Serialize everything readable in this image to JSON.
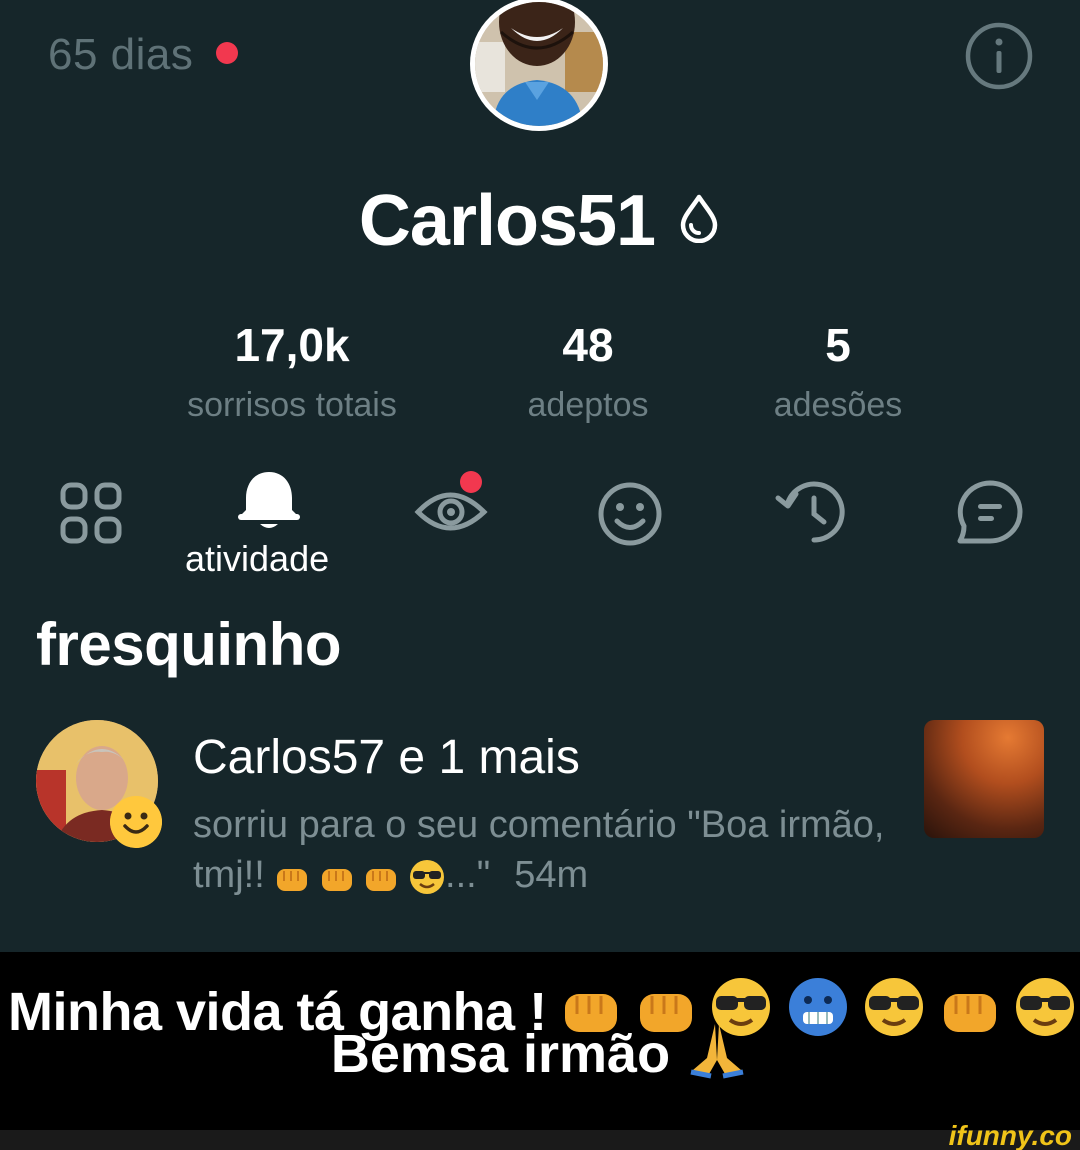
{
  "header": {
    "streak": "65 dias",
    "streak_dot_color": "#f2384f",
    "info_icon": "info-icon"
  },
  "profile": {
    "username": "Carlos51",
    "badge_icon": "water-drop-icon"
  },
  "stats": [
    {
      "value": "17,0k",
      "label": "sorrisos totais"
    },
    {
      "value": "48",
      "label": "adeptos"
    },
    {
      "value": "5",
      "label": "adesões"
    }
  ],
  "tabs": [
    {
      "icon": "grid-icon"
    },
    {
      "icon": "bell-icon",
      "label": "atividade",
      "active": true
    },
    {
      "icon": "eye-icon",
      "has_notification": true
    },
    {
      "icon": "smiley-icon"
    },
    {
      "icon": "history-icon"
    },
    {
      "icon": "chat-icon"
    }
  ],
  "section": {
    "title": "fresquinho"
  },
  "notification": {
    "actor": "Carlos57 e 1 mais",
    "text": "sorriu para o seu comentário \"Boa irmão, tmj!!",
    "text_end": "...\"",
    "time": "54m"
  },
  "caption": {
    "line1": "Minha vida tá ganha !",
    "line2": "Bemsa irmão"
  },
  "branding": {
    "watermark": "ifunny.co"
  },
  "colors": {
    "background": "#16262a",
    "muted_text": "#6d7f84",
    "accent_red": "#f2384f"
  }
}
